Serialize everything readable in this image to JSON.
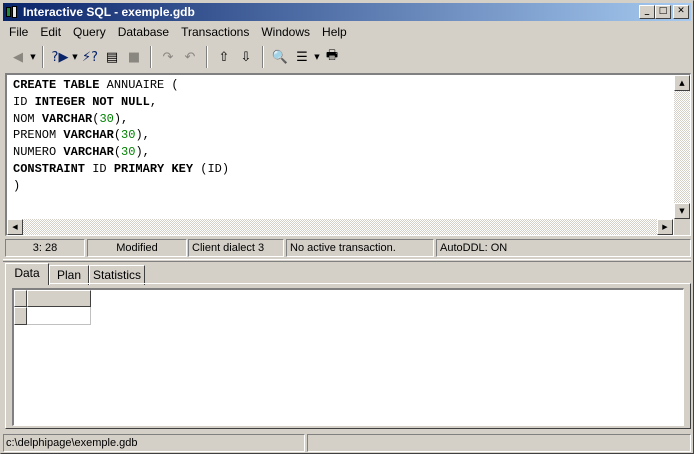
{
  "window": {
    "title": "Interactive SQL - exemple.gdb"
  },
  "titlebar_buttons": {
    "minimize": "_",
    "maximize": "□",
    "close": "✕"
  },
  "menu": [
    "File",
    "Edit",
    "Query",
    "Database",
    "Transactions",
    "Windows",
    "Help"
  ],
  "toolbar": {
    "icons": [
      "back-arrow-icon",
      "run-query-icon",
      "query-help-icon",
      "query-doc-icon",
      "stop-icon",
      "redo-icon",
      "undo-icon",
      "export-icon",
      "import-icon",
      "find-icon",
      "tree-view-icon",
      "print-icon"
    ],
    "glyphs": {
      "back": "◀",
      "run": "?▶",
      "help": "⚡?",
      "doc": "▤",
      "stop": "■",
      "redo": "↷",
      "undo": "↶",
      "export": "⇧",
      "import": "⇩",
      "find": "🔍",
      "tree": "☰",
      "print": "🖶",
      "dropdown": "▼"
    }
  },
  "editor": {
    "lines": [
      [
        {
          "t": "CREATE TABLE",
          "c": "kw"
        },
        {
          "t": " ANNUAIRE (",
          "c": ""
        }
      ],
      [
        {
          "t": "ID ",
          "c": ""
        },
        {
          "t": "INTEGER NOT NULL",
          "c": "kw"
        },
        {
          "t": ",",
          "c": ""
        }
      ],
      [
        {
          "t": "NOM ",
          "c": ""
        },
        {
          "t": "VARCHAR",
          "c": "kw"
        },
        {
          "t": "(",
          "c": ""
        },
        {
          "t": "30",
          "c": "num"
        },
        {
          "t": "),",
          "c": ""
        }
      ],
      [
        {
          "t": "PRENOM ",
          "c": ""
        },
        {
          "t": "VARCHAR",
          "c": "kw"
        },
        {
          "t": "(",
          "c": ""
        },
        {
          "t": "30",
          "c": "num"
        },
        {
          "t": "),",
          "c": ""
        }
      ],
      [
        {
          "t": "NUMERO ",
          "c": ""
        },
        {
          "t": "VARCHAR",
          "c": "kw"
        },
        {
          "t": "(",
          "c": ""
        },
        {
          "t": "30",
          "c": "num"
        },
        {
          "t": "),",
          "c": ""
        }
      ],
      [
        {
          "t": "CONSTRAINT",
          "c": "kw"
        },
        {
          "t": " ID ",
          "c": ""
        },
        {
          "t": "PRIMARY KEY",
          "c": "kw"
        },
        {
          "t": " (ID)",
          "c": ""
        }
      ],
      [
        {
          "t": ")",
          "c": ""
        }
      ]
    ],
    "scroll_glyphs": {
      "up": "▲",
      "down": "▼",
      "left": "◀",
      "right": "▶"
    }
  },
  "status": {
    "position": "3: 28",
    "modified": "Modified",
    "dialect": "Client dialect 3",
    "transaction": "No active transaction.",
    "autoddl": "AutoDDL: ON"
  },
  "tabs": [
    "Data",
    "Plan",
    "Statistics"
  ],
  "active_tab": "Data",
  "bottom_status": {
    "path": "c:\\delphipage\\exemple.gdb",
    "second": ""
  }
}
